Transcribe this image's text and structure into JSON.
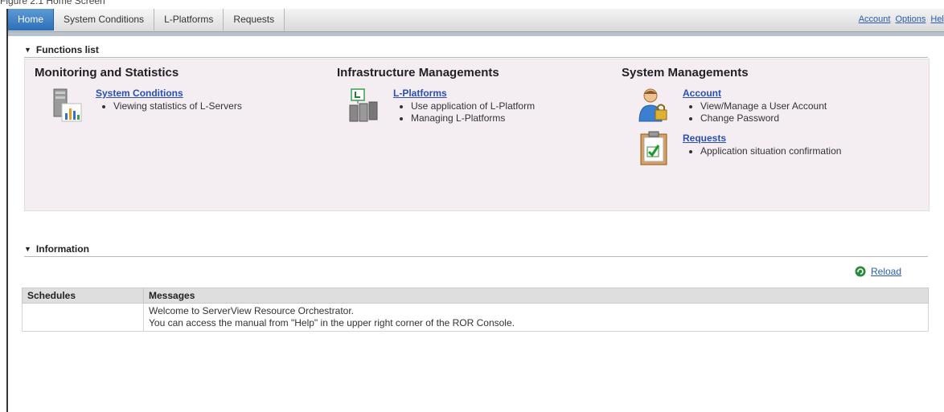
{
  "caption": "Figure 2.1 Home Screen",
  "tabs": [
    {
      "label": "Home",
      "active": true
    },
    {
      "label": "System Conditions",
      "active": false
    },
    {
      "label": "L-Platforms",
      "active": false
    },
    {
      "label": "Requests",
      "active": false
    }
  ],
  "top_links": {
    "account": "Account",
    "options": "Options",
    "help": "Help"
  },
  "functions_list": {
    "title": "Functions list",
    "monitoring": {
      "title": "Monitoring and Statistics",
      "system_conditions": {
        "link": "System Conditions",
        "items": [
          "Viewing statistics of L-Servers"
        ]
      }
    },
    "infrastructure": {
      "title": "Infrastructure Managements",
      "l_platforms": {
        "link": "L-Platforms",
        "items": [
          "Use application of L-Platform",
          "Managing L-Platforms"
        ]
      }
    },
    "system": {
      "title": "System Managements",
      "account": {
        "link": "Account",
        "items": [
          "View/Manage a User Account",
          "Change Password"
        ]
      },
      "requests": {
        "link": "Requests",
        "items": [
          "Application situation confirmation"
        ]
      }
    }
  },
  "information": {
    "title": "Information",
    "reload": "Reload",
    "columns": {
      "schedules": "Schedules",
      "messages": "Messages"
    },
    "rows": [
      {
        "schedule": "",
        "message_lines": [
          "Welcome to ServerView Resource Orchestrator.",
          "You can access the manual from \"Help\" in the upper right corner of the ROR Console."
        ]
      }
    ]
  }
}
